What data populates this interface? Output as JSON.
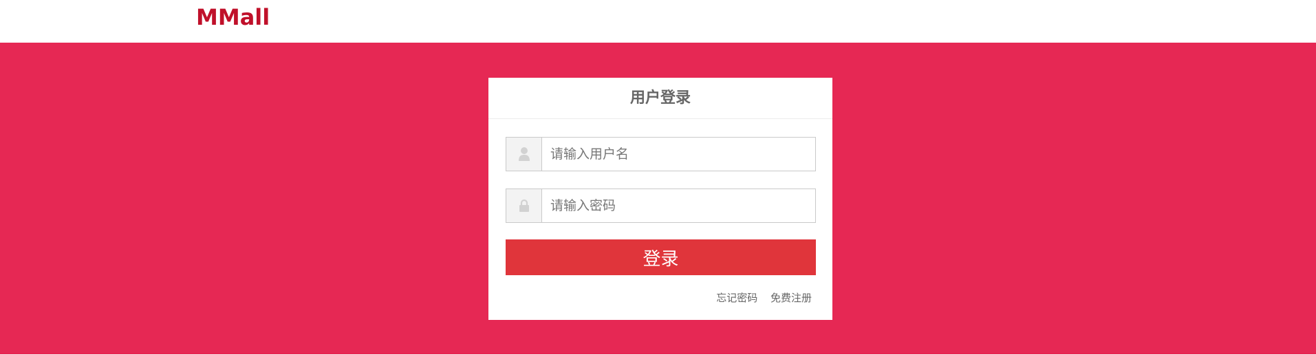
{
  "header": {
    "logo_text": "MMall"
  },
  "login": {
    "title": "用户登录",
    "username": {
      "icon": "user-icon",
      "placeholder": "请输入用户名",
      "value": ""
    },
    "password": {
      "icon": "lock-icon",
      "placeholder": "请输入密码",
      "value": ""
    },
    "submit_label": "登录",
    "forgot_password": "忘记密码",
    "register": "免费注册"
  },
  "colors": {
    "brand": "#c0102a",
    "banner_bg": "#e62854",
    "button_bg": "#e0353b"
  }
}
